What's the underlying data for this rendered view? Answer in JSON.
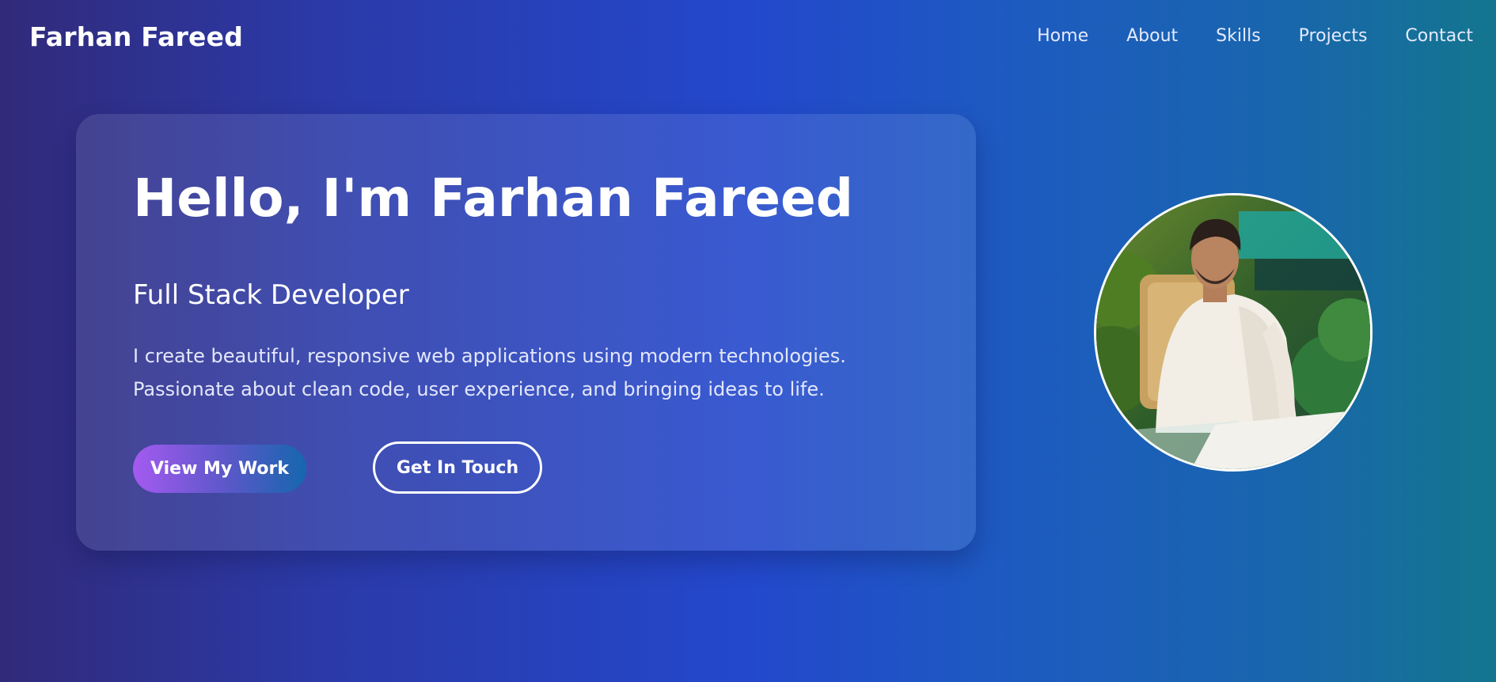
{
  "nav": {
    "brand": "Farhan Fareed",
    "links": [
      "Home",
      "About",
      "Skills",
      "Projects",
      "Contact"
    ]
  },
  "hero": {
    "title": "Hello, I'm Farhan Fareed",
    "subtitle": "Full Stack Developer",
    "description_line1": "I create beautiful, responsive web applications using modern technologies.",
    "description_line2": "Passionate about clean code, user experience, and bringing ideas to life.",
    "primary_button": "View My Work",
    "secondary_button": "Get In Touch"
  },
  "avatar": {
    "icon": "profile-photo"
  },
  "colors": {
    "background_start": "#312a7a",
    "background_mid": "#2348cc",
    "background_end": "#13768e",
    "button_gradient_start": "#a45af0",
    "button_gradient_end": "#1567ae",
    "text": "#ffffff"
  }
}
